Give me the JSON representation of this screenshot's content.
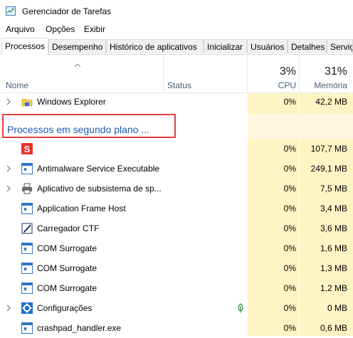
{
  "window": {
    "title": "Gerenciador de Tarefas"
  },
  "menu": [
    "Arquivo",
    "Opções",
    "Exibir"
  ],
  "tabs": [
    "Processos",
    "Desempenho",
    "Histórico de aplicativos",
    "Inicializar",
    "Usuários",
    "Detalhes",
    "Serviç"
  ],
  "active_tab": "Processos",
  "columns": {
    "name": "Nome",
    "status": "Status",
    "cpu_pct": "3%",
    "cpu": "CPU",
    "mem_pct": "31%",
    "mem": "Memória"
  },
  "group_label": "Processos em segundo plano ...",
  "rows": [
    {
      "name": "Windows Explorer",
      "cpu": "0%",
      "mem": "42,2 MB",
      "icon": "folder-icon",
      "expand": false
    },
    {
      "name": "",
      "cpu": "0%",
      "mem": "107,7 MB",
      "icon": "s-app-icon",
      "expand": false
    },
    {
      "name": "Antimalware Service Executable",
      "cpu": "0%",
      "mem": "249,1 MB",
      "icon": "window-icon",
      "expand": true
    },
    {
      "name": "Aplicativo de subsistema de sp...",
      "cpu": "0%",
      "mem": "7,5 MB",
      "icon": "printer-icon",
      "expand": true
    },
    {
      "name": "Application Frame Host",
      "cpu": "0%",
      "mem": "3,4 MB",
      "icon": "window-icon",
      "expand": false
    },
    {
      "name": "Carregador CTF",
      "cpu": "0%",
      "mem": "3,6 MB",
      "icon": "pen-icon",
      "expand": false
    },
    {
      "name": "COM Surrogate",
      "cpu": "0%",
      "mem": "1,6 MB",
      "icon": "window-icon",
      "expand": false
    },
    {
      "name": "COM Surrogate",
      "cpu": "0%",
      "mem": "1,3 MB",
      "icon": "window-icon",
      "expand": false
    },
    {
      "name": "COM Surrogate",
      "cpu": "0%",
      "mem": "1,2 MB",
      "icon": "window-icon",
      "expand": false
    },
    {
      "name": "Configurações",
      "cpu": "0%",
      "mem": "0 MB",
      "icon": "gear-icon",
      "expand": true,
      "status_icon": "leaf-icon"
    },
    {
      "name": "crashpad_handler.exe",
      "cpu": "0%",
      "mem": "0,6 MB",
      "icon": "window-icon",
      "expand": false
    }
  ]
}
